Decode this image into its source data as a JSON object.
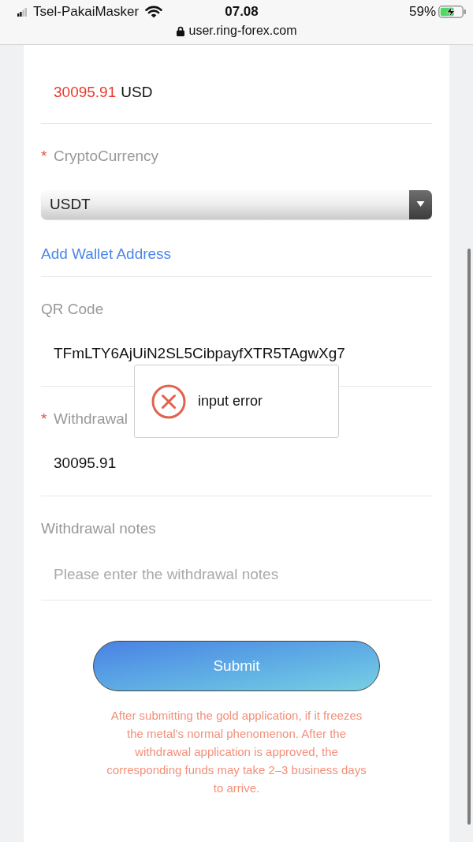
{
  "status_bar": {
    "carrier": "Tsel-PakaiMasker",
    "time": "07.08",
    "battery": "59%",
    "charging": true
  },
  "address_bar": {
    "url": "user.ring-forex.com"
  },
  "form": {
    "fields": [
      {
        "kind": "amount",
        "value": "30095.91",
        "unit": "USD"
      },
      {
        "kind": "select",
        "required_mark": "*",
        "label": "CryptoCurrency",
        "value": "USDT",
        "link": "Add Wallet Address"
      },
      {
        "kind": "text",
        "label": "QR Code",
        "value": "TFmLTY6AjUiN2SL5CibpayfXTR5TAgwXg7"
      },
      {
        "kind": "text",
        "required_mark": "*",
        "label": "Withdrawal",
        "value": "30095.91"
      },
      {
        "kind": "input",
        "label": "Withdrawal notes",
        "placeholder": "Please enter the withdrawal notes"
      }
    ],
    "submit": "Submit",
    "notice": "After submitting the gold application, if it freezes the metal's normal phenomenon. After the withdrawal application is approved, the corresponding funds may take 2–3 business days to arrive."
  },
  "toast": {
    "kind": "error",
    "message": "input error"
  }
}
